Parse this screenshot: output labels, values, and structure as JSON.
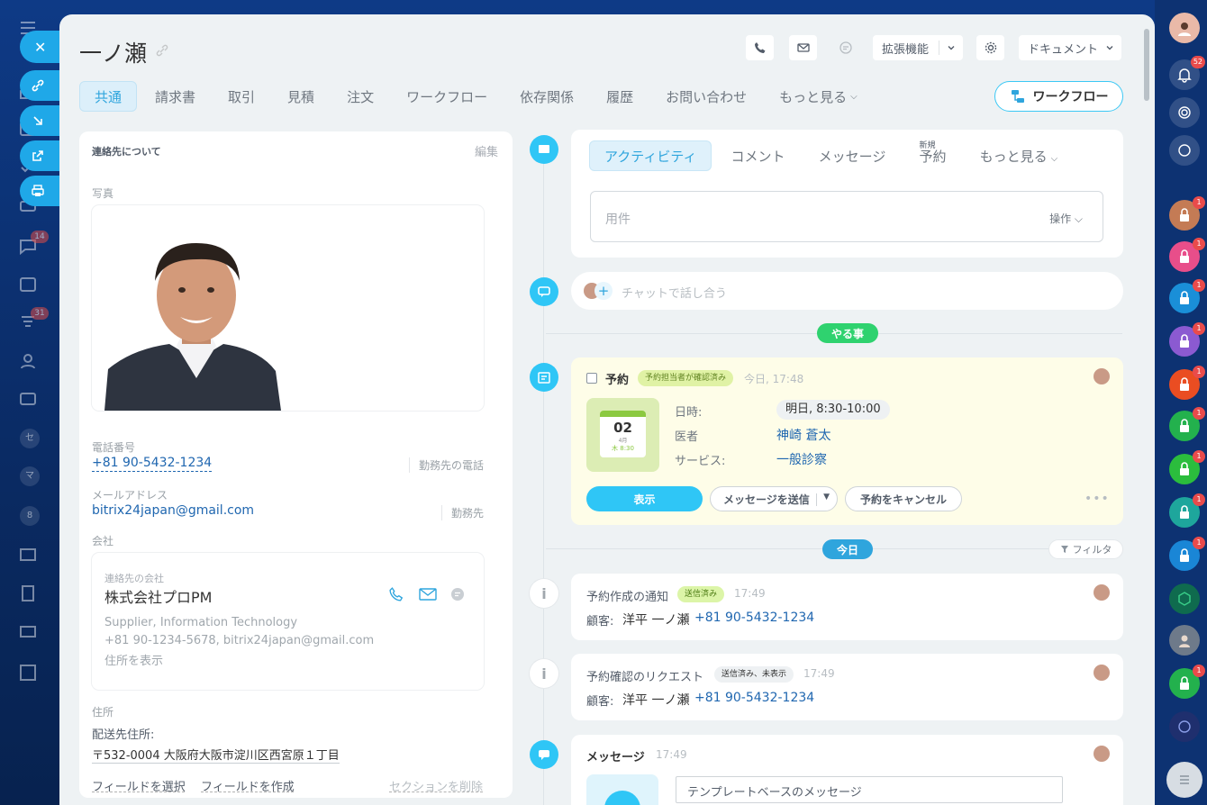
{
  "contact": {
    "name": "一ノ瀬",
    "tabs": [
      "共通",
      "請求書",
      "取引",
      "見積",
      "注文",
      "ワークフロー",
      "依存関係",
      "履歴",
      "お問い合わせ",
      "もっと見る"
    ],
    "header_buttons": {
      "extensions": "拡張機能",
      "documents": "ドキュメント"
    },
    "workflow_button": "ワークフロー"
  },
  "left_nav": {
    "badges": {
      "chat": "14",
      "feed": "31"
    },
    "letters": [
      "セ",
      "マ",
      "8"
    ]
  },
  "right_bar": {
    "notifications": "52",
    "lock_badges": [
      "1",
      "1",
      "1",
      "1",
      "1",
      "1",
      "1",
      "1",
      "1",
      "1"
    ]
  },
  "about": {
    "title": "連絡先について",
    "edit": "編集",
    "photo_label": "写真",
    "phone_label": "電話番号",
    "phone": "+81 90-5432-1234",
    "phone_type": "勤務先の電話",
    "email_label": "メールアドレス",
    "email": "bitrix24japan@gmail.com",
    "email_type": "勤務先",
    "company_label": "会社",
    "company": {
      "sublabel": "連絡先の会社",
      "name": "株式会社プロPM",
      "industry": "Supplier, Information Technology",
      "contacts": "+81 90-1234-5678, bitrix24japan@gmail.com",
      "show_address": "住所を表示"
    },
    "address_label": "住所",
    "delivery_label": "配送先住所:",
    "address": "〒532-0004 大阪府大阪市淀川区西宮原１丁目",
    "select_field": "フィールドを選択",
    "create_field": "フィールドを作成",
    "delete_section": "セクションを削除"
  },
  "activity": {
    "tabs": [
      "アクティビティ",
      "コメント",
      "メッセージ",
      "予約",
      "もっと見る"
    ],
    "new_label": "新規",
    "subject_placeholder": "用件",
    "actions_label": "操作",
    "chat_placeholder": "チャットで話し合う"
  },
  "todo": {
    "label": "やる事",
    "booking": {
      "title": "予約",
      "status": "予約担当者が確認済み",
      "time": "今日, 17:48",
      "date_day": "02",
      "date_month": "4月",
      "date_time": "木 8:30",
      "date_label": "日時:",
      "date_value": "明日, 8:30-10:00",
      "doctor_label": "医者",
      "doctor_value": "神崎 蒼太",
      "service_label": "サービス:",
      "service_value": "一般診察",
      "btn_show": "表示",
      "btn_message": "メッセージを送信",
      "btn_cancel": "予約をキャンセル",
      "more": "•••"
    }
  },
  "today": {
    "label": "今日",
    "filter": "フィルタ",
    "items": [
      {
        "title": "予約作成の通知",
        "badge": "送信済み",
        "time": "17:49",
        "client_label": "顧客:",
        "client_name": "洋平 一ノ瀬",
        "client_phone": "+81 90-5432-1234"
      },
      {
        "title": "予約確認のリクエスト",
        "badge": "送信済み、未表示",
        "time": "17:49",
        "client_label": "顧客:",
        "client_name": "洋平 一ノ瀬",
        "client_phone": "+81 90-5432-1234"
      }
    ],
    "message": {
      "title": "メッセージ",
      "time": "17:49",
      "template": "テンプレートベースのメッセージ"
    }
  },
  "colors": {
    "accent": "#2fc6f6",
    "green": "#2fd26f",
    "link": "#2067b0",
    "booking_bg": "#fefde8"
  }
}
